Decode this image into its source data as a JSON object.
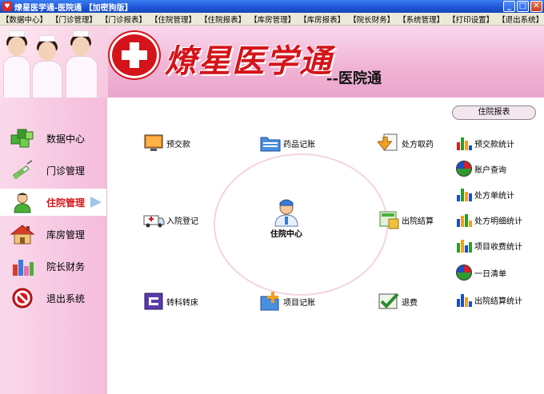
{
  "window": {
    "title": "燎星医学通-医院通 【加密狗版】"
  },
  "menu": [
    "【数据中心】",
    "【门诊管理】",
    "【门诊报表】",
    "【住院管理】",
    "【住院报表】",
    "【库房管理】",
    "【库房报表】",
    "【院长财务】",
    "【系统管理】",
    "【打印设置】",
    "【退出系统】"
  ],
  "banner": {
    "brand": "燎星医学通",
    "subbrand": "--医院通"
  },
  "sidebar": {
    "items": [
      {
        "label": "数据中心",
        "icon": "cubes-icon"
      },
      {
        "label": "门诊管理",
        "icon": "syringe-icon"
      },
      {
        "label": "住院管理",
        "icon": "patient-icon",
        "active": true
      },
      {
        "label": "库房管理",
        "icon": "warehouse-icon"
      },
      {
        "label": "院长财务",
        "icon": "finance-chart-icon"
      },
      {
        "label": "退出系统",
        "icon": "exit-icon"
      }
    ]
  },
  "main": {
    "center_label": "住院中心",
    "functions": [
      {
        "label": "预交款",
        "icon": "monitor-icon"
      },
      {
        "label": "药品记账",
        "icon": "folder-icon"
      },
      {
        "label": "处方取药",
        "icon": "prescription-download-icon"
      },
      {
        "label": "入院登记",
        "icon": "ambulance-icon"
      },
      {
        "label": "出院结算",
        "icon": "calculator-icon"
      },
      {
        "label": "转科转床",
        "icon": "transfer-icon"
      },
      {
        "label": "项目记账",
        "icon": "folder-plus-icon"
      },
      {
        "label": "退费",
        "icon": "check-refund-icon"
      }
    ]
  },
  "right_panel": {
    "title": "住院报表",
    "items": [
      {
        "label": "预交款统计",
        "icon": "bar-chart-icon"
      },
      {
        "label": "账户查询",
        "icon": "pie-chart-icon"
      },
      {
        "label": "处方单统计",
        "icon": "bar-chart-icon"
      },
      {
        "label": "处方明细统计",
        "icon": "bar-chart-icon"
      },
      {
        "label": "项目收费统计",
        "icon": "bar-chart-icon"
      },
      {
        "label": "一日清单",
        "icon": "pie-chart-icon"
      },
      {
        "label": "出院结算统计",
        "icon": "bar-chart-icon"
      }
    ]
  },
  "colors": {
    "accent_red": "#d4141a",
    "banner_pink": "#f0b2d4",
    "titlebar_blue": "#1c55d8"
  }
}
